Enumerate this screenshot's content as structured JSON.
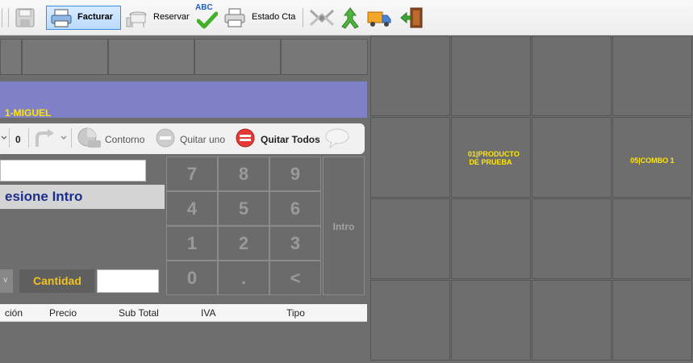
{
  "toolbar": {
    "facturar_label": "Facturar",
    "reservar_label": "Reservar",
    "estado_cta_label": "Estado Cta",
    "spell_icon_text": "ABC"
  },
  "order": {
    "header_label": "1-MIGUEL",
    "zero_label": "0",
    "contorno_label": "Contorno",
    "quitar_uno_label": "Quitar uno",
    "quitar_todos_label": "Quitar Todos",
    "prompt_text": "esione Intro",
    "cantidad_label": "Cantidad",
    "cantidad_value": ""
  },
  "keypad": {
    "keys": [
      "7",
      "8",
      "9",
      "4",
      "5",
      "6",
      "1",
      "2",
      "3",
      "0",
      ".",
      "<"
    ],
    "intro_label": "Intro"
  },
  "table": {
    "columns": [
      "ción",
      "Precio",
      "Sub Total",
      "IVA",
      "Tipo"
    ]
  },
  "products": {
    "cells": [
      "",
      "",
      "",
      "",
      "",
      "01|PRODUCTO DE PRUEBA",
      "",
      "05|COMBO 1",
      "",
      "",
      "",
      "",
      "",
      "",
      "",
      ""
    ]
  },
  "colors": {
    "accent_yellow": "#ffe700",
    "header_purple": "#8080c6",
    "quantity_gold": "#f1c021",
    "prompt_blue": "#1c2f8c",
    "remove_red": "#e53935"
  }
}
